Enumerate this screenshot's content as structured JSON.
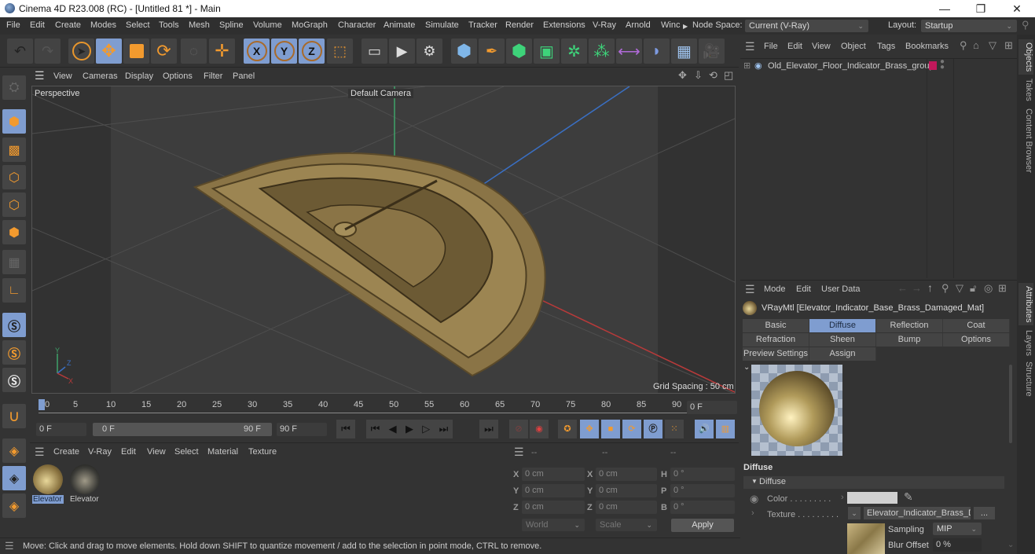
{
  "window": {
    "title": "Cinema 4D R23.008 (RC) - [Untitled 81 *] - Main",
    "controls": {
      "minimize": "—",
      "maximize": "❐",
      "close": "✕"
    }
  },
  "menubar": {
    "items": [
      "File",
      "Edit",
      "Create",
      "Modes",
      "Select",
      "Tools",
      "Mesh",
      "Spline",
      "Volume",
      "MoGraph",
      "Character",
      "Animate",
      "Simulate",
      "Tracker",
      "Render",
      "Extensions",
      "V-Ray",
      "Arnold",
      "Winc"
    ],
    "node_space_label": "Node Space:",
    "node_space_value": "Current (V-Ray)",
    "layout_label": "Layout:",
    "layout_value": "Startup"
  },
  "toolbar": {
    "icons": [
      "undo-icon",
      "redo-icon",
      "select-icon",
      "move-icon",
      "scale-icon",
      "rotate-icon",
      "recent-tools-icon",
      "create-move-icon",
      "x-axis-icon",
      "y-axis-icon",
      "z-axis-icon",
      "coordinate-system-icon",
      "render-view-icon",
      "render-picture-viewer-icon",
      "render-settings-icon",
      "cube-icon",
      "pen-icon",
      "subdivision-icon",
      "extrude-icon",
      "cloner-icon",
      "mograph-icon",
      "deformer-icon",
      "field-icon",
      "floor-icon",
      "camera-icon"
    ],
    "axis_labels": {
      "x": "X",
      "y": "Y",
      "z": "Z"
    }
  },
  "viewport": {
    "menu": [
      "View",
      "Cameras",
      "Display",
      "Options",
      "Filter",
      "Panel"
    ],
    "view_name": "Perspective",
    "camera": "Default Camera",
    "grid_spacing": "Grid Spacing : 50 cm",
    "axis": {
      "x": "X",
      "y": "Y",
      "z": "Z"
    }
  },
  "timeline": {
    "ticks": [
      "0",
      "5",
      "10",
      "15",
      "20",
      "25",
      "30",
      "35",
      "40",
      "45",
      "50",
      "55",
      "60",
      "65",
      "70",
      "75",
      "80",
      "85",
      "90"
    ],
    "current_frame": "0 F",
    "start_frame": "0 F",
    "range_start": "0 F",
    "range_end": "90 F",
    "end_frame": "90 F"
  },
  "material_manager": {
    "menu": [
      "Create",
      "V-Ray",
      "Edit",
      "View",
      "Select",
      "Material",
      "Texture"
    ],
    "materials": [
      {
        "name": "Elevator",
        "selected": true
      },
      {
        "name": "Elevator",
        "selected": false
      }
    ]
  },
  "coordinates": {
    "headers": [
      "--",
      "--",
      "--"
    ],
    "rows": [
      {
        "pos_label": "X",
        "pos": "0 cm",
        "size_label": "X",
        "size": "0 cm",
        "rot_label": "H",
        "rot": "0 °"
      },
      {
        "pos_label": "Y",
        "pos": "0 cm",
        "size_label": "Y",
        "size": "0 cm",
        "rot_label": "P",
        "rot": "0 °"
      },
      {
        "pos_label": "Z",
        "pos": "0 cm",
        "size_label": "Z",
        "size": "0 cm",
        "rot_label": "B",
        "rot": "0 °"
      }
    ],
    "space": "World",
    "mode": "Scale",
    "apply": "Apply"
  },
  "status": "Move: Click and drag to move elements. Hold down SHIFT to quantize movement / add to the selection in point mode, CTRL to remove.",
  "objects_panel": {
    "menu": [
      "File",
      "Edit",
      "View",
      "Object",
      "Tags",
      "Bookmarks"
    ],
    "objects": [
      {
        "name": "Old_Elevator_Floor_Indicator_Brass_group",
        "tag_color": "#c2185b"
      }
    ]
  },
  "attributes_panel": {
    "menu": [
      "Mode",
      "Edit",
      "User Data"
    ],
    "material_title": "VRayMtl [Elevator_Indicator_Base_Brass_Damaged_Mat]",
    "tabs": [
      {
        "label": "Basic",
        "selected": false
      },
      {
        "label": "Diffuse",
        "selected": true
      },
      {
        "label": "Reflection",
        "selected": false
      },
      {
        "label": "Coat",
        "selected": false
      },
      {
        "label": "Refraction",
        "selected": false
      },
      {
        "label": "Sheen",
        "selected": false
      },
      {
        "label": "Bump",
        "selected": false
      },
      {
        "label": "Options",
        "selected": false
      },
      {
        "label": "Preview Settings",
        "selected": false
      },
      {
        "label": "Assign",
        "selected": false
      }
    ],
    "section_title": "Diffuse",
    "group_title": "Diffuse",
    "color_label": "Color . . . . . . . . .",
    "color_value": "#d0d0d0",
    "texture_label": "Texture . . . . . . . . .",
    "texture_value": "Elevator_Indicator_Brass_Da",
    "texture_more": "...",
    "sampling_label": "Sampling",
    "sampling_value": "MIP",
    "blur_label": "Blur Offset",
    "blur_value": "0 %"
  },
  "right_tabs": {
    "top": [
      "Objects",
      "Takes",
      "Content Browser"
    ],
    "bottom": [
      "Attributes",
      "Layers",
      "Structure"
    ]
  },
  "colors": {
    "accent": "#7f9dd0",
    "panel_bg": "#333333",
    "viewport_bg": "#3d3d3d",
    "orange": "#f29a2e"
  }
}
